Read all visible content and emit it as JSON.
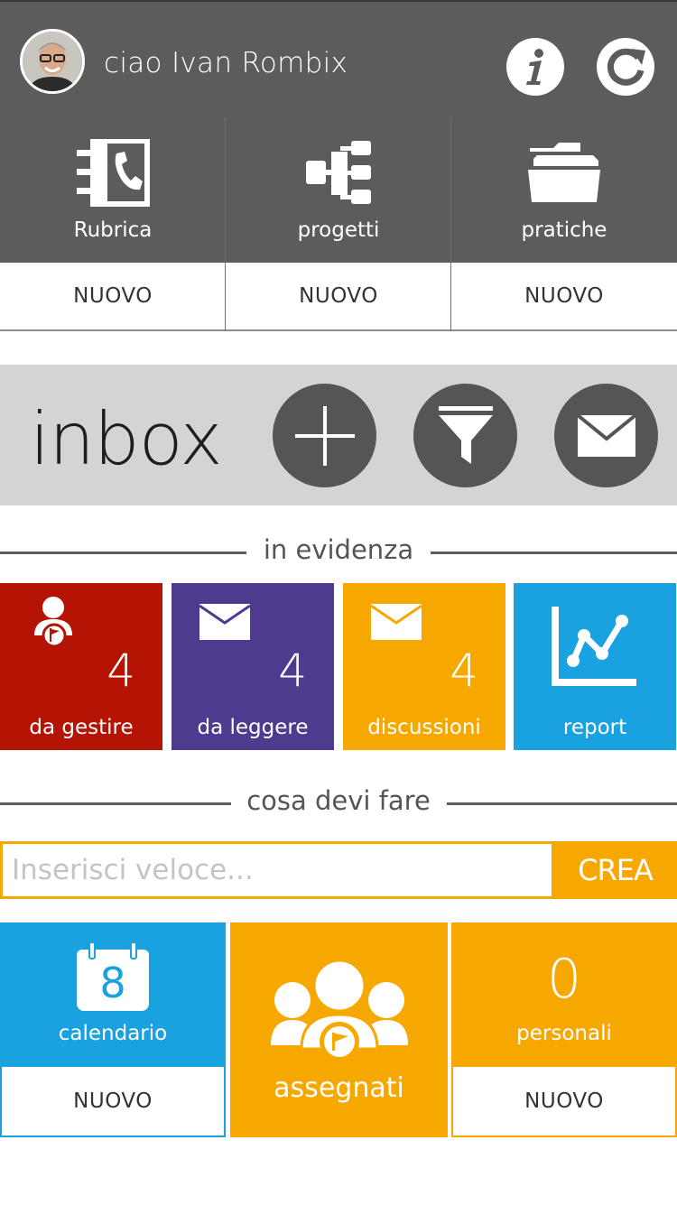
{
  "header": {
    "greeting": "ciao Ivan Rombix",
    "info_icon": "info-icon",
    "refresh_icon": "refresh-icon"
  },
  "quick_actions": [
    {
      "label": "Rubrica",
      "icon": "address-book-icon",
      "new_label": "NUOVO"
    },
    {
      "label": "progetti",
      "icon": "hierarchy-icon",
      "new_label": "NUOVO"
    },
    {
      "label": "pratiche",
      "icon": "folder-icon",
      "new_label": "NUOVO"
    }
  ],
  "inbox": {
    "title": "inbox",
    "buttons": [
      "plus-icon",
      "filter-icon",
      "mail-icon"
    ]
  },
  "highlight": {
    "heading": "in evidenza",
    "tiles": [
      {
        "label": "da gestire",
        "count": "4",
        "icon": "user-flag-icon",
        "color": "#b51405"
      },
      {
        "label": "da leggere",
        "count": "4",
        "icon": "envelope-icon",
        "color": "#4e3b8f"
      },
      {
        "label": "discussioni",
        "count": "4",
        "icon": "envelope-icon",
        "color": "#f7a800"
      },
      {
        "label": "report",
        "count": "",
        "icon": "chart-line-icon",
        "color": "#1aa1e0"
      }
    ]
  },
  "todo": {
    "heading": "cosa devi fare",
    "input_placeholder": "Inserisci veloce...",
    "create_label": "CREA"
  },
  "bottom_tiles": {
    "calendar": {
      "label": "calendario",
      "day": "8",
      "new_label": "NUOVO",
      "color": "#1aa1e0"
    },
    "assigned": {
      "label": "assegnati",
      "color": "#f7a800"
    },
    "personal": {
      "label": "personali",
      "count": "0",
      "new_label": "NUOVO",
      "color": "#f7a800"
    }
  }
}
